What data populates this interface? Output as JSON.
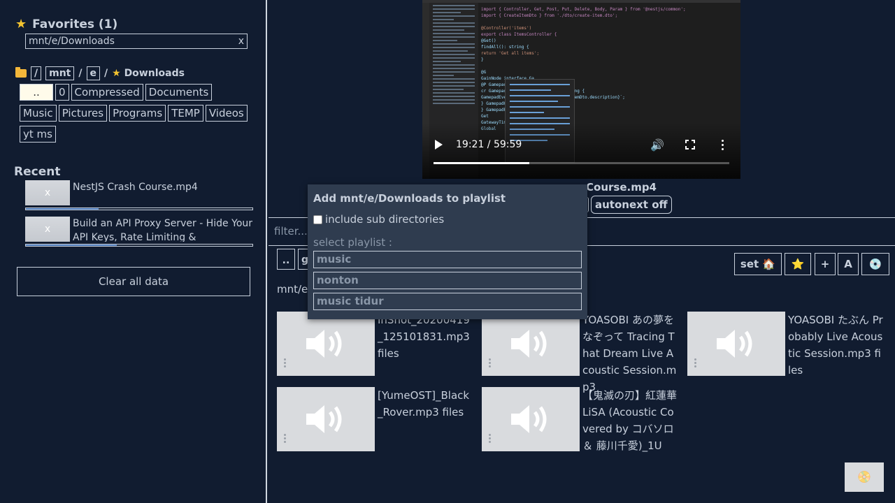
{
  "sidebar": {
    "favorites_title": "Favorites (1)",
    "favorite_path": "mnt/e/Downloads",
    "favorite_clear": "x",
    "breadcrumb": [
      "/",
      "mnt",
      "e",
      "Downloads"
    ],
    "breadcrumb_sep": "/",
    "folders": [
      "..",
      "0",
      "Compressed",
      "Documents",
      "Music",
      "Pictures",
      "Programs",
      "TEMP",
      "Videos",
      "yt ms"
    ],
    "recent_title": "Recent",
    "recent": [
      {
        "title": "NestJS Crash Course.mp4",
        "thumb_label": "x",
        "progress": 0.32
      },
      {
        "title": "Build an API Proxy Server - Hide Your API Keys, Rate Limiting & Caching.mp4",
        "thumb_label": "x",
        "progress": 0.4
      }
    ],
    "clear_label": "Clear all data"
  },
  "player": {
    "time": "19:21 / 59:59",
    "progress": 0.324,
    "now_playing": "Course.mp4",
    "autonext_label": "autonext off",
    "code_lines": [
      "import { Controller, Get, Post, Put, Delete, Body, Param } from '@nestjs/common';",
      "import { CreateItemDto } from './dto/create-item.dto';",
      "",
      "@Controller('items')",
      "export class ItemsController {",
      "  @Get()",
      "  findAll(): string {",
      "    return 'Get all items';",
      "  }",
      "",
      "  @G",
      "    GainNode  interface Ga...",
      "  @P  Gamepad",
      "  cr  GamepadButton        CreateItemDto): string {",
      "      GamepadEvent         o.name} Desc: ${createItemDto.description}`;",
      "  }   GamepadHapticActuator",
      "}     GamepadPose",
      "      Get",
      "      GatewayTimeoutException",
      "      Global"
    ]
  },
  "filter": {
    "placeholder": "filter..."
  },
  "nav": {
    "up_label": "..",
    "second_label": "g",
    "path": "mnt/e/"
  },
  "toolbar": {
    "set_label": "set 🏠",
    "star_label": "⭐",
    "plus_label": "+",
    "a_label": "A",
    "disc_label": "💿"
  },
  "media": [
    {
      "name": "InShot_20200419_125101831.mp3 files"
    },
    {
      "name": "YOASOBI あの夢をなぞって Tracing That Dream Live Acoustic Session.mp3"
    },
    {
      "name": "YOASOBI たぶん Probably Live Acoustic Session.mp3 files"
    },
    {
      "name": "[YumeOST]_Black_Rover.mp3 files"
    },
    {
      "name": "【鬼滅の刃】紅蓮華 LiSA (Acoustic Covered by コバソロ ＆ 藤川千愛)_1U"
    }
  ],
  "corner_label": "📀",
  "modal": {
    "title": "Add mnt/e/Downloads to playlist",
    "include_label": "include sub directories",
    "select_label": "select playlist :",
    "playlists": [
      "music",
      "nonton",
      "music tidur"
    ]
  }
}
